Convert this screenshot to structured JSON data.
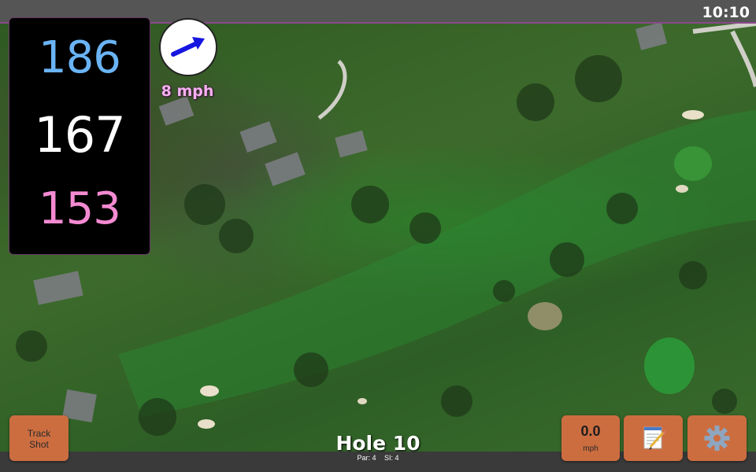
{
  "status_bar": {
    "clock": "10:10"
  },
  "yardage": {
    "back": "186",
    "middle": "167",
    "front": "153"
  },
  "wind": {
    "speed": "8 mph",
    "icon": "wind-direction-arrow-icon"
  },
  "hole": {
    "title": "Hole 10",
    "par_label": "Par: 4",
    "si_label": "SI: 4"
  },
  "buttons": {
    "track_shot_line1": "Track",
    "track_shot_line2": "Shot",
    "speed_value": "0.0",
    "speed_unit": "mph",
    "notes_icon": "notepad-icon",
    "settings_icon": "gear-icon"
  },
  "colors": {
    "back_distance": "#6ab4f5",
    "middle_distance": "#ffffff",
    "front_distance": "#f48ad2",
    "wind_text": "#f6b0f0",
    "button_bg": "#cc6d40",
    "status_bar_bg": "#555555",
    "wind_arrow": "#1616e0"
  }
}
